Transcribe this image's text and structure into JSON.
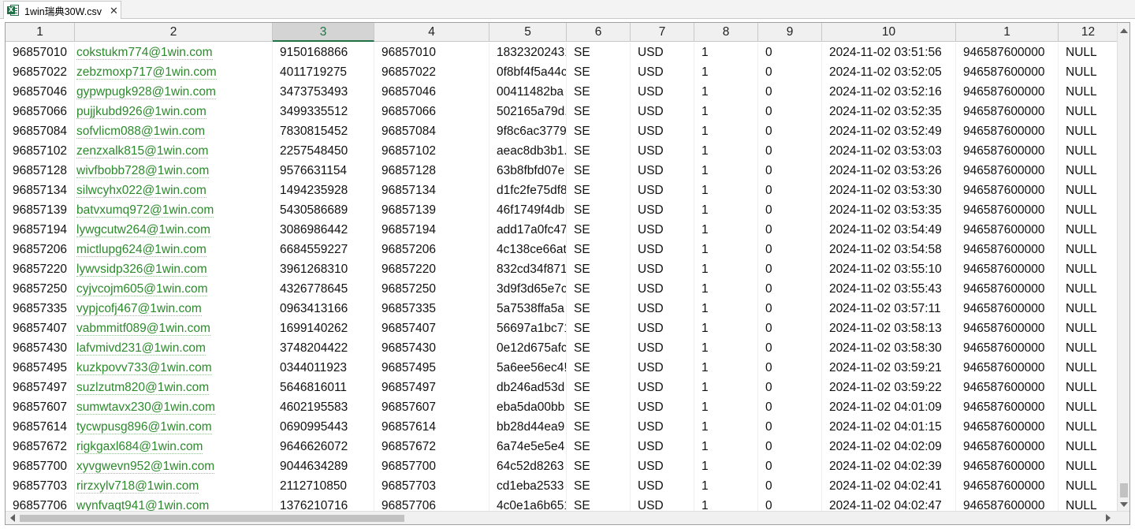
{
  "tab": {
    "title": "1win瑞典30W.csv",
    "close_glyph": "✕",
    "icon": "excel-file-icon"
  },
  "accent_color": "#217346",
  "email_color": "#2c8a2c",
  "columns": [
    "1",
    "2",
    "3",
    "4",
    "5",
    "6",
    "7",
    "8",
    "9",
    "10",
    "1",
    "12"
  ],
  "selected_column": 2,
  "rows": [
    [
      "96857010",
      "cokstukm774@1win.com",
      "9150168866",
      "96857010",
      "18323202431",
      "SE",
      "USD",
      "1",
      "0",
      "2024-11-02 03:51:56",
      "946587600000",
      "NULL"
    ],
    [
      "96857022",
      "zebzmoxp717@1win.com",
      "4011719275",
      "96857022",
      "0f8bf4f5a44c",
      "SE",
      "USD",
      "1",
      "0",
      "2024-11-02 03:52:05",
      "946587600000",
      "NULL"
    ],
    [
      "96857046",
      "gypwpugk928@1win.com",
      "3473753493",
      "96857046",
      "00411482ba",
      "SE",
      "USD",
      "1",
      "0",
      "2024-11-02 03:52:16",
      "946587600000",
      "NULL"
    ],
    [
      "96857066",
      "pujjkubd926@1win.com",
      "3499335512",
      "96857066",
      "502165a79d.",
      "SE",
      "USD",
      "1",
      "0",
      "2024-11-02 03:52:35",
      "946587600000",
      "NULL"
    ],
    [
      "96857084",
      "sofvlicm088@1win.com",
      "7830815452",
      "96857084",
      "9f8c6ac3779",
      "SE",
      "USD",
      "1",
      "0",
      "2024-11-02 03:52:49",
      "946587600000",
      "NULL"
    ],
    [
      "96857102",
      "zenzxalk815@1win.com",
      "2257548450",
      "96857102",
      "aeac8db3b1.",
      "SE",
      "USD",
      "1",
      "0",
      "2024-11-02 03:53:03",
      "946587600000",
      "NULL"
    ],
    [
      "96857128",
      "wivfbobb728@1win.com",
      "9576631154",
      "96857128",
      "63b8fbfd07e",
      "SE",
      "USD",
      "1",
      "0",
      "2024-11-02 03:53:26",
      "946587600000",
      "NULL"
    ],
    [
      "96857134",
      "silwcyhx022@1win.com",
      "1494235928",
      "96857134",
      "d1fc2fe75df8",
      "SE",
      "USD",
      "1",
      "0",
      "2024-11-02 03:53:30",
      "946587600000",
      "NULL"
    ],
    [
      "96857139",
      "batvxumq972@1win.com",
      "5430586689",
      "96857139",
      "46f1749f4db",
      "SE",
      "USD",
      "1",
      "0",
      "2024-11-02 03:53:35",
      "946587600000",
      "NULL"
    ],
    [
      "96857194",
      "lywgcutw264@1win.com",
      "3086986442",
      "96857194",
      "add17a0fc47",
      "SE",
      "USD",
      "1",
      "0",
      "2024-11-02 03:54:49",
      "946587600000",
      "NULL"
    ],
    [
      "96857206",
      "mictlupg624@1win.com",
      "6684559227",
      "96857206",
      "4c138ce66at",
      "SE",
      "USD",
      "1",
      "0",
      "2024-11-02 03:54:58",
      "946587600000",
      "NULL"
    ],
    [
      "96857220",
      "lywvsidp326@1win.com",
      "3961268310",
      "96857220",
      "832cd34f871",
      "SE",
      "USD",
      "1",
      "0",
      "2024-11-02 03:55:10",
      "946587600000",
      "NULL"
    ],
    [
      "96857250",
      "cyjvcojm605@1win.com",
      "4326778645",
      "96857250",
      "3d9f3d65e7c",
      "SE",
      "USD",
      "1",
      "0",
      "2024-11-02 03:55:43",
      "946587600000",
      "NULL"
    ],
    [
      "96857335",
      "vypjcofj467@1win.com",
      "0963413166",
      "96857335",
      "5a7538ffa5a",
      "SE",
      "USD",
      "1",
      "0",
      "2024-11-02 03:57:11",
      "946587600000",
      "NULL"
    ],
    [
      "96857407",
      "vabmmitf089@1win.com",
      "1699140262",
      "96857407",
      "56697a1bc71",
      "SE",
      "USD",
      "1",
      "0",
      "2024-11-02 03:58:13",
      "946587600000",
      "NULL"
    ],
    [
      "96857430",
      "lafvmivd231@1win.com",
      "3748204422",
      "96857430",
      "0e12d675afc",
      "SE",
      "USD",
      "1",
      "0",
      "2024-11-02 03:58:30",
      "946587600000",
      "NULL"
    ],
    [
      "96857495",
      "kuzkpovv733@1win.com",
      "0344011923",
      "96857495",
      "5a6ee56ec4!",
      "SE",
      "USD",
      "1",
      "0",
      "2024-11-02 03:59:21",
      "946587600000",
      "NULL"
    ],
    [
      "96857497",
      "suzlzutm820@1win.com",
      "5646816011",
      "96857497",
      "db246ad53d",
      "SE",
      "USD",
      "1",
      "0",
      "2024-11-02 03:59:22",
      "946587600000",
      "NULL"
    ],
    [
      "96857607",
      "sumwtavx230@1win.com",
      "4602195583",
      "96857607",
      "eba5da00bb",
      "SE",
      "USD",
      "1",
      "0",
      "2024-11-02 04:01:09",
      "946587600000",
      "NULL"
    ],
    [
      "96857614",
      "tycwpusg896@1win.com",
      "0690995443",
      "96857614",
      "bb28d44ea9",
      "SE",
      "USD",
      "1",
      "0",
      "2024-11-02 04:01:15",
      "946587600000",
      "NULL"
    ],
    [
      "96857672",
      "rigkgaxl684@1win.com",
      "9646626072",
      "96857672",
      "6a74e5e5e4",
      "SE",
      "USD",
      "1",
      "0",
      "2024-11-02 04:02:09",
      "946587600000",
      "NULL"
    ],
    [
      "96857700",
      "xyvgwevn952@1win.com",
      "9044634289",
      "96857700",
      "64c52d8263",
      "SE",
      "USD",
      "1",
      "0",
      "2024-11-02 04:02:39",
      "946587600000",
      "NULL"
    ],
    [
      "96857703",
      "rirzxylv718@1win.com",
      "2112710850",
      "96857703",
      "cd1eba2533",
      "SE",
      "USD",
      "1",
      "0",
      "2024-11-02 04:02:41",
      "946587600000",
      "NULL"
    ],
    [
      "96857706",
      "wynfvaqt941@1win.com",
      "1376210716",
      "96857706",
      "4c0e1a6b651",
      "SE",
      "USD",
      "1",
      "0",
      "2024-11-02 04:02:47",
      "946587600000",
      "NULL"
    ]
  ]
}
